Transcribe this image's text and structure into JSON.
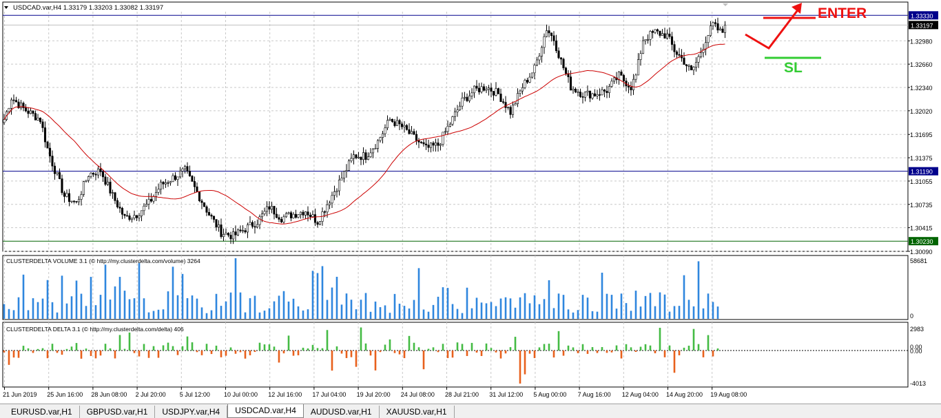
{
  "chart_data": {
    "type": "candlestick",
    "symbol_header": "USDCAD.var,H4  1.33179 1.33203 1.33082 1.33197",
    "price_axis_ticks": [
      "1.32980",
      "1.32660",
      "1.32340",
      "1.32020",
      "1.31695",
      "1.31375",
      "1.31055",
      "1.30735",
      "1.30415",
      "1.30090"
    ],
    "price_range": [
      1.3009,
      1.3338
    ],
    "price_lines": [
      {
        "label": "1.33330",
        "value": 1.3333,
        "color": "#00008b"
      },
      {
        "label": "1.33197",
        "value": 1.33197,
        "color": "#000000"
      },
      {
        "label": "1.31190",
        "value": 1.3119,
        "color": "#00008b"
      },
      {
        "label": "1.30230",
        "value": 1.3023,
        "color": "#006400"
      }
    ],
    "moving_average_color": "#cc0000",
    "time_labels": [
      "21 Jun 2019",
      "25 Jun 16:00",
      "28 Jun 08:00",
      "2 Jul 20:00",
      "5 Jul 12:00",
      "10 Jul 00:00",
      "12 Jul 16:00",
      "17 Jul 04:00",
      "19 Jul 20:00",
      "24 Jul 08:00",
      "28 Jul 21:00",
      "31 Jul 12:00",
      "5 Aug 00:00",
      "7 Aug 16:00",
      "12 Aug 04:00",
      "14 Aug 20:00",
      "19 Aug 08:00"
    ],
    "price_path": [
      [
        0,
        1.319
      ],
      [
        3,
        1.322
      ],
      [
        8,
        1.3205
      ],
      [
        15,
        1.319
      ],
      [
        18,
        1.315
      ],
      [
        20,
        1.313
      ],
      [
        25,
        1.3085
      ],
      [
        30,
        1.3075
      ],
      [
        35,
        1.3115
      ],
      [
        40,
        1.312
      ],
      [
        45,
        1.3085
      ],
      [
        50,
        1.3055
      ],
      [
        55,
        1.306
      ],
      [
        60,
        1.3075
      ],
      [
        65,
        1.31
      ],
      [
        70,
        1.311
      ],
      [
        75,
        1.312
      ],
      [
        80,
        1.309
      ],
      [
        85,
        1.306
      ],
      [
        90,
        1.3035
      ],
      [
        95,
        1.303
      ],
      [
        100,
        1.304
      ],
      [
        105,
        1.305
      ],
      [
        110,
        1.307
      ],
      [
        115,
        1.3055
      ],
      [
        120,
        1.306
      ],
      [
        125,
        1.3065
      ],
      [
        130,
        1.305
      ],
      [
        135,
        1.308
      ],
      [
        140,
        1.311
      ],
      [
        145,
        1.314
      ],
      [
        150,
        1.314
      ],
      [
        155,
        1.316
      ],
      [
        160,
        1.319
      ],
      [
        165,
        1.318
      ],
      [
        170,
        1.3165
      ],
      [
        175,
        1.315
      ],
      [
        180,
        1.3155
      ],
      [
        185,
        1.3185
      ],
      [
        190,
        1.3215
      ],
      [
        195,
        1.323
      ],
      [
        200,
        1.3235
      ],
      [
        205,
        1.3225
      ],
      [
        210,
        1.32
      ],
      [
        215,
        1.3235
      ],
      [
        220,
        1.326
      ],
      [
        225,
        1.3315
      ],
      [
        228,
        1.33
      ],
      [
        231,
        1.327
      ],
      [
        235,
        1.3235
      ],
      [
        240,
        1.3225
      ],
      [
        245,
        1.3225
      ],
      [
        250,
        1.323
      ],
      [
        255,
        1.325
      ],
      [
        260,
        1.3235
      ],
      [
        262,
        1.325
      ],
      [
        265,
        1.33
      ],
      [
        270,
        1.331
      ],
      [
        275,
        1.3305
      ],
      [
        278,
        1.3285
      ],
      [
        282,
        1.327
      ],
      [
        285,
        1.3255
      ],
      [
        288,
        1.3275
      ],
      [
        291,
        1.33
      ],
      [
        294,
        1.332
      ],
      [
        297,
        1.331
      ]
    ],
    "volume_panel": {
      "label": "CLUSTERDELTA VOLUME 3.1 (© http://my.clusterdelta.com/volume) 3264",
      "axis_max": "58681",
      "axis_min": "0",
      "bar_color": "#2e86de"
    },
    "delta_panel": {
      "label": "CLUSTERDELTA DELTA 3.1 (© http://my.clusterdelta.com/delta) 406",
      "ticks": [
        "2983",
        "0.00",
        "0.00",
        "-4013"
      ],
      "positive_color": "#44bb44",
      "negative_color": "#e8601c"
    }
  },
  "annotations": {
    "enter": "ENTER",
    "sl": "SL",
    "enter_color": "#ee1111",
    "sl_color": "#33cc33"
  },
  "tabs": [
    "EURUSD.var,H1",
    "GBPUSD.var,H1",
    "USDJPY.var,H4",
    "USDCAD.var,H4",
    "AUDUSD.var,H1",
    "XAUUSD.var,H1"
  ],
  "active_tab": "USDCAD.var,H4"
}
